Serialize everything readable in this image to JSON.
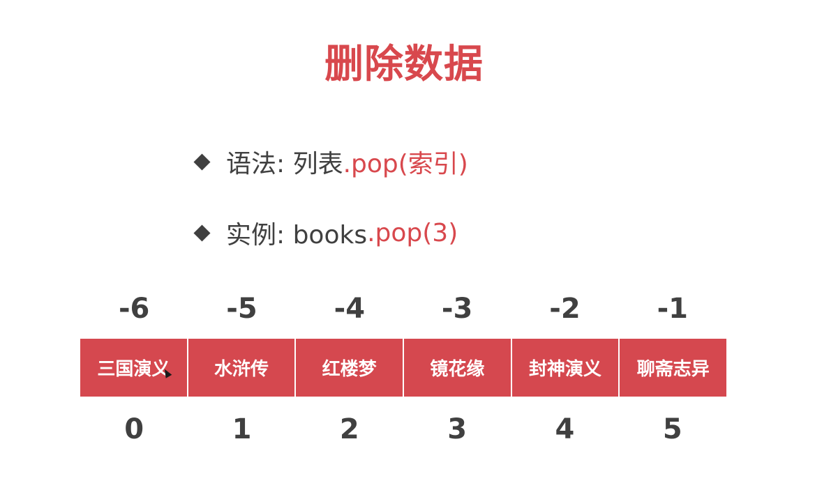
{
  "slide": {
    "title": "删除数据",
    "syntax": {
      "prefix": "语法: 列表",
      "highlight": ".pop(索引)"
    },
    "example": {
      "prefix": "实例: books",
      "highlight": ".pop(3)"
    },
    "negative_indices": [
      "-6",
      "-5",
      "-4",
      "-3",
      "-2",
      "-1"
    ],
    "books": [
      "三国演义",
      "水浒传",
      "红楼梦",
      "镜花缘",
      "封神演义",
      "聊斋志异"
    ],
    "positive_indices": [
      "0",
      "1",
      "2",
      "3",
      "4",
      "5"
    ]
  },
  "colors": {
    "accent": "#d8484d",
    "text": "#404040",
    "box": "#d5484f"
  }
}
